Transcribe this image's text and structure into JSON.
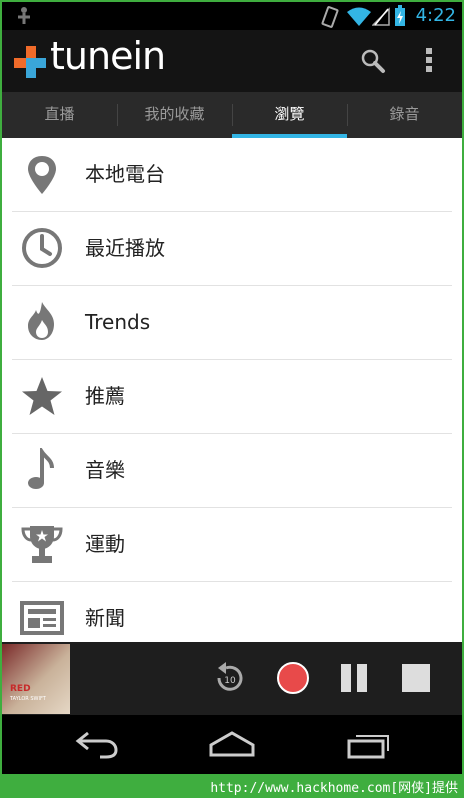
{
  "status": {
    "time": "4:22",
    "icons": [
      "usb-debug-icon",
      "vibrate-icon",
      "wifi-icon",
      "signal-icon",
      "battery-charging-icon"
    ]
  },
  "app": {
    "logo_text": "tunein",
    "brand_color": "#f06b2a",
    "actions": [
      "search-icon",
      "overflow-menu-icon"
    ]
  },
  "tabs": [
    {
      "label": "直播",
      "active": false
    },
    {
      "label": "我的收藏",
      "active": false
    },
    {
      "label": "瀏覽",
      "active": true
    },
    {
      "label": "錄音",
      "active": false
    }
  ],
  "accent_color": "#33b5e5",
  "list": [
    {
      "label": "本地電台",
      "icon": "location-pin-icon"
    },
    {
      "label": "最近播放",
      "icon": "clock-icon"
    },
    {
      "label": "Trends",
      "icon": "flame-icon"
    },
    {
      "label": "推薦",
      "icon": "star-icon"
    },
    {
      "label": "音樂",
      "icon": "music-note-icon"
    },
    {
      "label": "運動",
      "icon": "trophy-icon"
    },
    {
      "label": "新聞",
      "icon": "newspaper-icon"
    }
  ],
  "player": {
    "album_title": "RED",
    "album_artist": "TAYLOR SWIFT",
    "rewind_seconds": "10",
    "controls": [
      "rewind-10-icon",
      "record-icon",
      "pause-icon",
      "stop-icon"
    ]
  },
  "nav": [
    "back-icon",
    "home-icon",
    "recent-apps-icon"
  ],
  "footer": {
    "watermark": "http://www.hackhome.com[网侠]提供"
  }
}
